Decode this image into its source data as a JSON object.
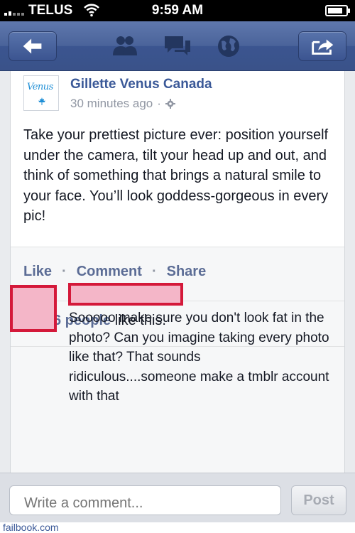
{
  "status_bar": {
    "carrier": "TELUS",
    "time": "9:59 AM"
  },
  "nav": {
    "icons": [
      "back-arrow-icon",
      "friends-icon",
      "messages-icon",
      "globe-icon",
      "share-icon"
    ],
    "colors": {
      "bar": "#3b5998",
      "button": "#4a639a"
    }
  },
  "post": {
    "page_name": "Gillette Venus Canada",
    "avatar_logo": "Venus",
    "timestamp": "30 minutes ago",
    "audience_icon": "gear-icon",
    "text": "Take your prettiest picture ever: position yourself under the camera, tilt your head up and out, and think of something that brings a natural smile to your face. You’ll look goddess-gorgeous in every pic!",
    "actions": {
      "like": "Like",
      "comment": "Comment",
      "share": "Share",
      "separator": "·"
    },
    "likes": {
      "count": "6 people",
      "suffix": " like this."
    }
  },
  "comment": {
    "text": "Sooooo make sure you don't look fat in the photo?  Can you imagine taking every photo like that?  That sounds ridiculous....someone make a tmblr account with that"
  },
  "composer": {
    "placeholder": "Write a comment...",
    "post_label": "Post"
  },
  "watermark": "failbook.com",
  "colors": {
    "link": "#3b5998",
    "redaction_fill": "#f4b6c8",
    "redaction_border": "#d4193a"
  }
}
